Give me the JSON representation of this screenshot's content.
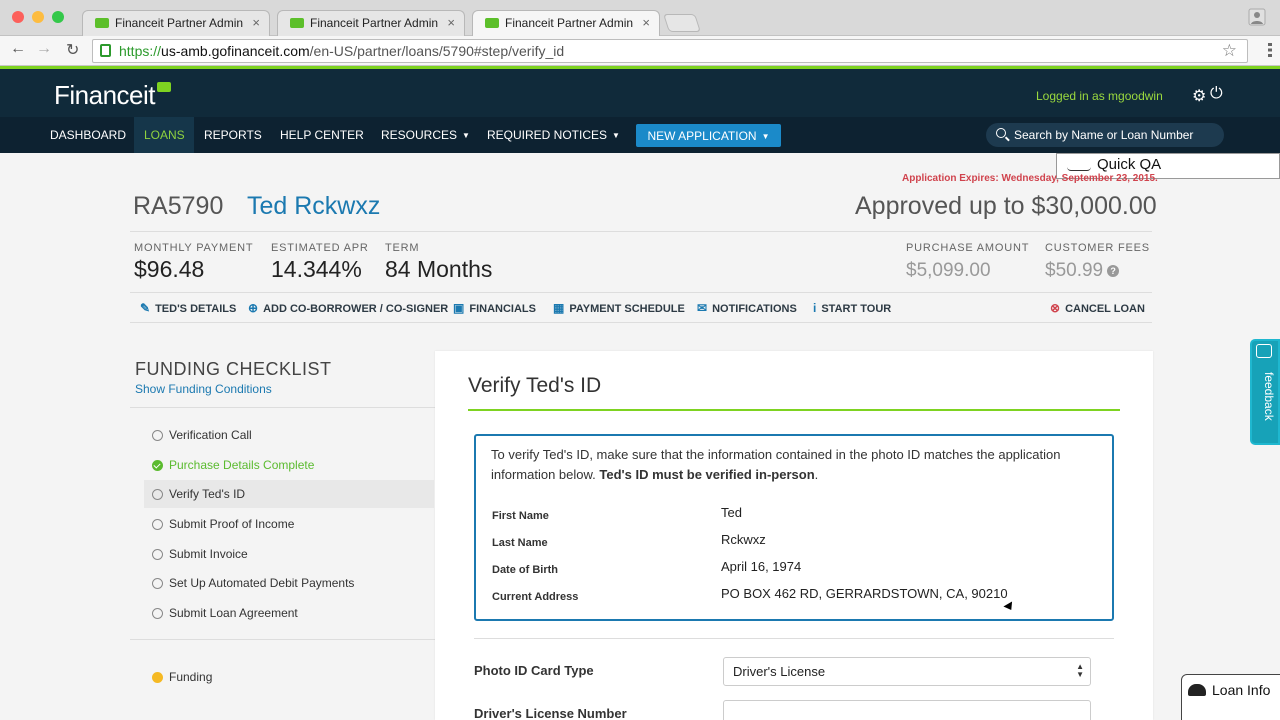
{
  "browser": {
    "tabs": [
      "Financeit Partner Admin",
      "Financeit Partner Admin",
      "Financeit Partner Admin"
    ],
    "url_scheme": "https://",
    "url_host": "us-amb.gofinanceit.com",
    "url_path": "/en-US/partner/loans/5790#step/verify_id"
  },
  "header": {
    "logo": "Financeit",
    "logged_in": "Logged in as mgoodwin"
  },
  "nav": {
    "items": [
      "DASHBOARD",
      "LOANS",
      "REPORTS",
      "HELP CENTER",
      "RESOURCES",
      "REQUIRED NOTICES"
    ],
    "active": "LOANS",
    "new_application": "NEW APPLICATION",
    "search_placeholder": "Search by Name or Loan Number"
  },
  "quick_qa": "Quick QA",
  "loan": {
    "expires": "Application Expires: Wednesday, September 23, 2015.",
    "id": "RA5790",
    "name": "Ted Rckwxz",
    "approved": "Approved up to $30,000.00",
    "stats": [
      {
        "label": "MONTHLY PAYMENT",
        "value": "$96.48"
      },
      {
        "label": "ESTIMATED APR",
        "value": "14.344%"
      },
      {
        "label": "TERM",
        "value": "84 Months"
      },
      {
        "label": "PURCHASE AMOUNT",
        "value": "$5,099.00"
      },
      {
        "label": "CUSTOMER FEES",
        "value": "$50.99"
      }
    ],
    "actions": [
      "TED'S DETAILS",
      "ADD CO-BORROWER / CO-SIGNER",
      "FINANCIALS",
      "PAYMENT SCHEDULE",
      "NOTIFICATIONS",
      "START TOUR",
      "CANCEL LOAN"
    ]
  },
  "checklist": {
    "title": "FUNDING CHECKLIST",
    "link": "Show Funding Conditions",
    "items": [
      "Verification Call",
      "Purchase Details Complete",
      "Verify Ted's ID",
      "Submit Proof of Income",
      "Submit Invoice",
      "Set Up Automated Debit Payments",
      "Submit Loan Agreement"
    ],
    "funding": "Funding"
  },
  "verify": {
    "title": "Verify Ted's ID",
    "intro": "To verify Ted's ID, make sure that the information contained in the photo ID matches the application information below.",
    "intro_bold": "Ted's ID must be verified in-person",
    "fields": [
      {
        "label": "First Name",
        "value": "Ted"
      },
      {
        "label": "Last Name",
        "value": "Rckwxz"
      },
      {
        "label": "Date of Birth",
        "value": "April 16, 1974"
      },
      {
        "label": "Current Address",
        "value": "PO BOX 462 RD, GERRARDSTOWN, CA, 90210"
      }
    ],
    "photo_id_label": "Photo ID Card Type",
    "photo_id_value": "Driver's License",
    "license_label": "Driver's License Number"
  },
  "feedback": "feedback",
  "loan_info": "Loan Info"
}
